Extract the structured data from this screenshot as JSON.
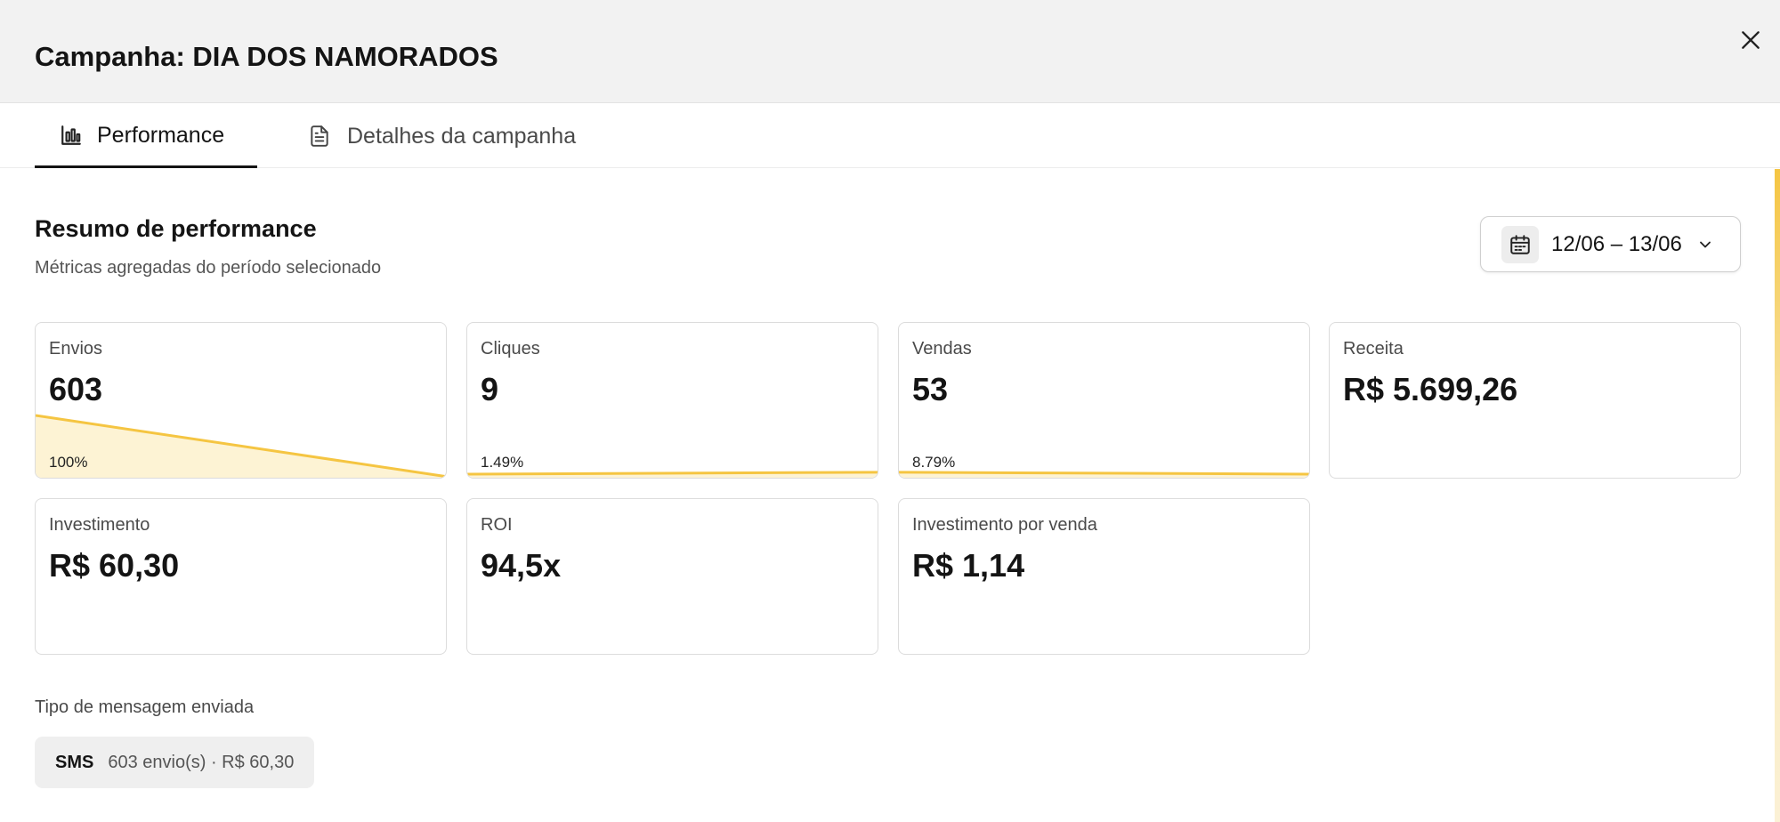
{
  "modal": {
    "title": "Campanha: DIA DOS NAMORADOS",
    "close_icon": "close-icon"
  },
  "tabs": [
    {
      "label": "Performance",
      "icon": "bar-chart-icon",
      "active": true
    },
    {
      "label": "Detalhes da campanha",
      "icon": "document-icon",
      "active": false
    }
  ],
  "summary": {
    "title": "Resumo de performance",
    "subtitle": "Métricas agregadas do período selecionado"
  },
  "date_range": {
    "label": "12/06 – 13/06",
    "icon": "calendar-icon",
    "chevron": "chevron-down-icon"
  },
  "metrics": [
    {
      "label": "Envios",
      "value": "603",
      "percent": "100%",
      "ratio": 1.0
    },
    {
      "label": "Cliques",
      "value": "9",
      "percent": "1.49%",
      "ratio": 0.0149
    },
    {
      "label": "Vendas",
      "value": "53",
      "percent": "8.79%",
      "ratio": 0.0879
    },
    {
      "label": "Receita",
      "value": "R$ 5.699,26"
    },
    {
      "label": "Investimento",
      "value": "R$ 60,30"
    },
    {
      "label": "ROI",
      "value": "94,5x"
    },
    {
      "label": "Investimento por venda",
      "value": "R$ 1,14"
    }
  ],
  "message_types": {
    "title": "Tipo de mensagem enviada",
    "items": [
      {
        "type": "SMS",
        "detail": "603 envio(s) · R$ 60,30"
      }
    ]
  },
  "colors": {
    "accent": "#f5c542",
    "accent_fill": "#fdf3d4",
    "header_bg": "#f2f2f2",
    "chip_bg": "#efefef"
  }
}
